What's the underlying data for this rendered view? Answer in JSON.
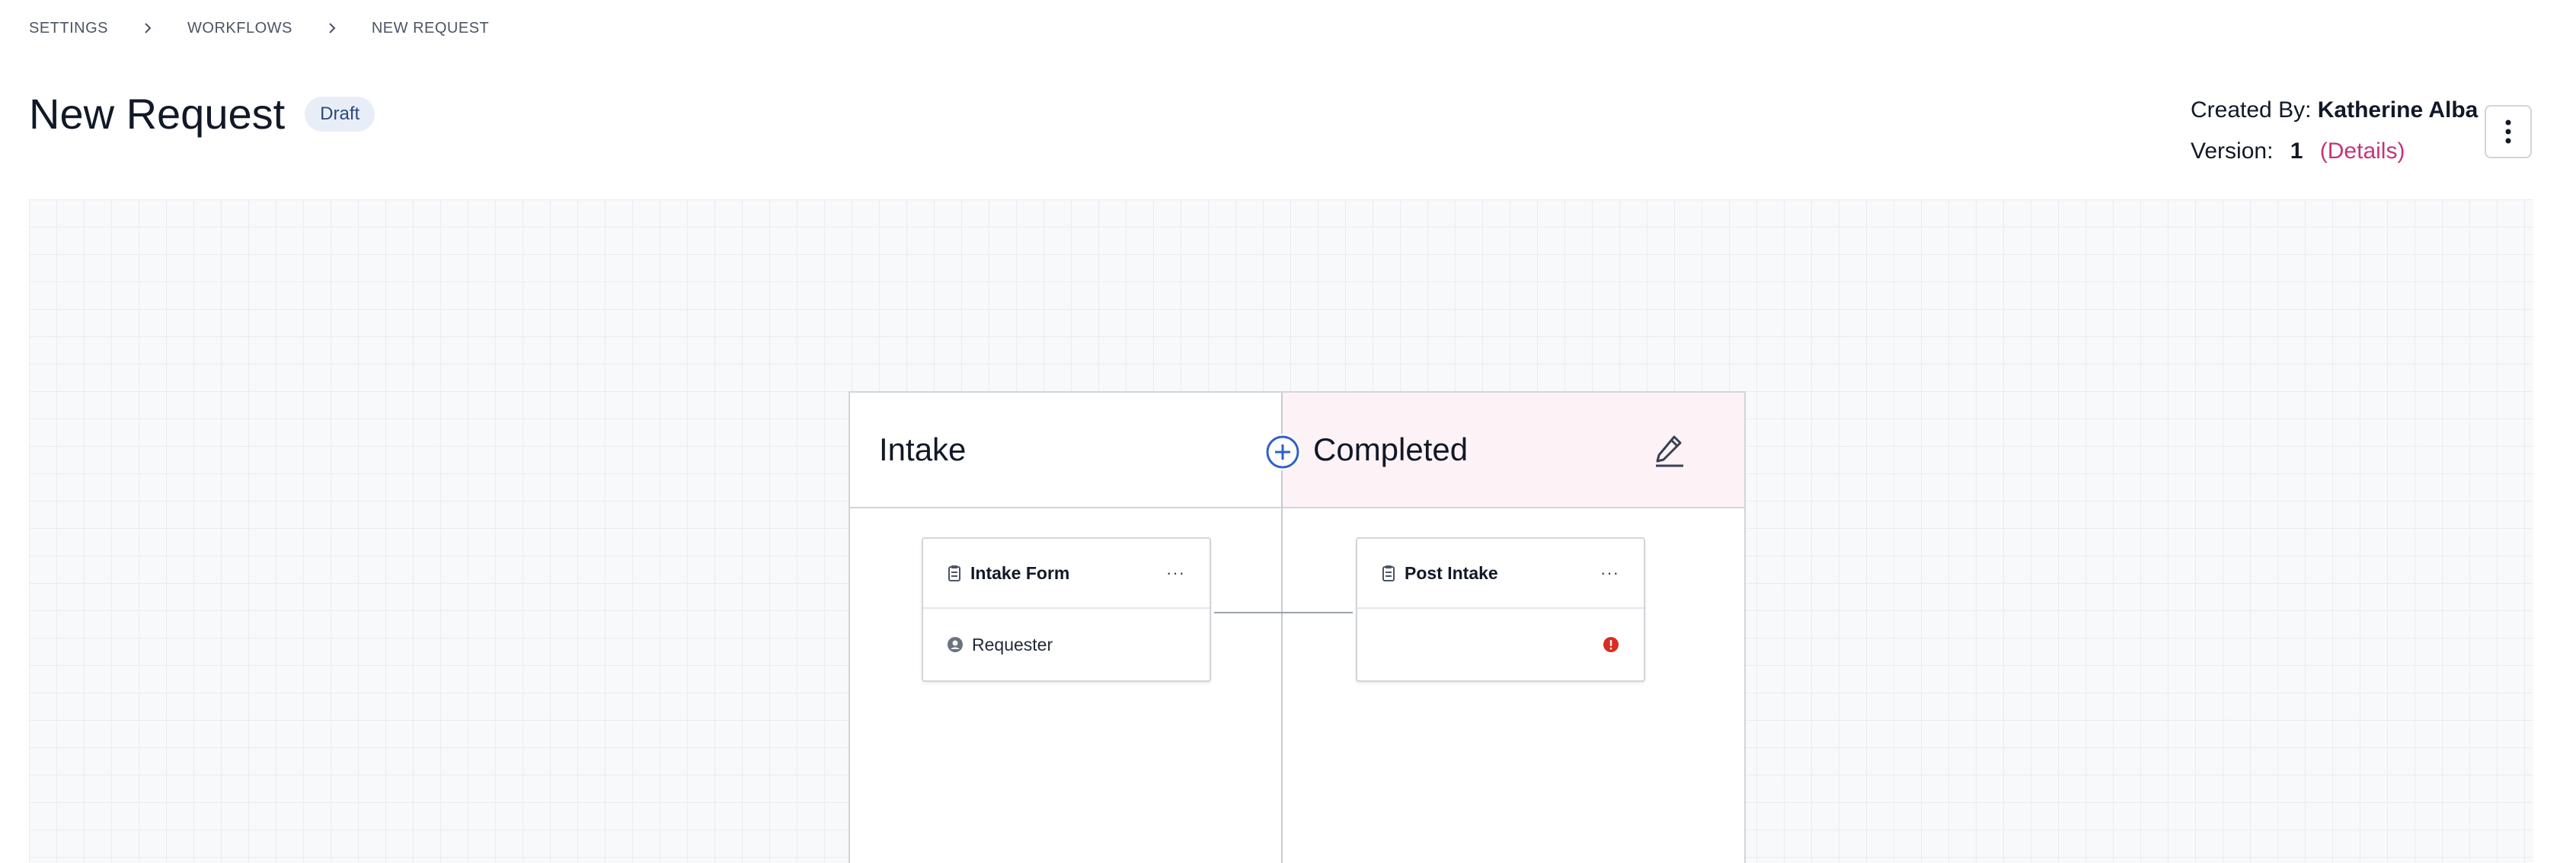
{
  "breadcrumb": {
    "items": [
      "SETTINGS",
      "WORKFLOWS",
      "NEW REQUEST"
    ]
  },
  "page": {
    "title": "New Request",
    "status": "Draft"
  },
  "meta": {
    "created_by_label": "Created By:",
    "created_by_value": "Katherine Alba",
    "version_label": "Version:",
    "version_value": "1",
    "details_link": "(Details)"
  },
  "workflow": {
    "stages": [
      {
        "title": "Intake"
      },
      {
        "title": "Completed"
      }
    ],
    "cards": [
      {
        "title": "Intake Form",
        "menu": "···",
        "assignee": "Requester",
        "icon": "clipboard-icon"
      },
      {
        "title": "Post Intake",
        "menu": "···",
        "assignee": "",
        "icon": "clipboard-icon",
        "status_icon": "error-icon"
      }
    ]
  },
  "colors": {
    "accent": "#2f5fd0",
    "badge_bg": "#e8eef8",
    "details_link": "#c2367a",
    "completed_stage_bg": "#fdf2f6",
    "error": "#d92d20"
  }
}
